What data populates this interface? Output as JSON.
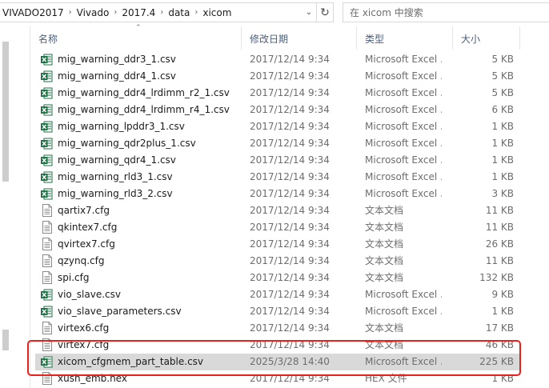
{
  "address": {
    "crumbs": [
      "VIVADO2017",
      "Vivado",
      "2017.4",
      "data",
      "xicom"
    ],
    "search_placeholder": "在 xicom 中搜索"
  },
  "columns": {
    "name": "名称",
    "date": "修改日期",
    "type": "类型",
    "size": "大小"
  },
  "rows": [
    {
      "name": "mig_warning_ddr3_1.csv",
      "date": "2017/12/14 9:34",
      "type": "Microsoft Excel ...",
      "size": "5 KB",
      "icon": "excel-csv-icon"
    },
    {
      "name": "mig_warning_ddr4_1.csv",
      "date": "2017/12/14 9:34",
      "type": "Microsoft Excel ...",
      "size": "5 KB",
      "icon": "excel-csv-icon"
    },
    {
      "name": "mig_warning_ddr4_lrdimm_r2_1.csv",
      "date": "2017/12/14 9:34",
      "type": "Microsoft Excel ...",
      "size": "5 KB",
      "icon": "excel-csv-icon"
    },
    {
      "name": "mig_warning_ddr4_lrdimm_r4_1.csv",
      "date": "2017/12/14 9:34",
      "type": "Microsoft Excel ...",
      "size": "6 KB",
      "icon": "excel-csv-icon"
    },
    {
      "name": "mig_warning_lpddr3_1.csv",
      "date": "2017/12/14 9:34",
      "type": "Microsoft Excel ...",
      "size": "1 KB",
      "icon": "excel-csv-icon"
    },
    {
      "name": "mig_warning_qdr2plus_1.csv",
      "date": "2017/12/14 9:34",
      "type": "Microsoft Excel ...",
      "size": "1 KB",
      "icon": "excel-csv-icon"
    },
    {
      "name": "mig_warning_qdr4_1.csv",
      "date": "2017/12/14 9:34",
      "type": "Microsoft Excel ...",
      "size": "1 KB",
      "icon": "excel-csv-icon"
    },
    {
      "name": "mig_warning_rld3_1.csv",
      "date": "2017/12/14 9:34",
      "type": "Microsoft Excel ...",
      "size": "1 KB",
      "icon": "excel-csv-icon"
    },
    {
      "name": "mig_warning_rld3_2.csv",
      "date": "2017/12/14 9:34",
      "type": "Microsoft Excel ...",
      "size": "3 KB",
      "icon": "excel-csv-icon"
    },
    {
      "name": "qartix7.cfg",
      "date": "2017/12/14 9:34",
      "type": "文本文档",
      "size": "11 KB",
      "icon": "text-file-icon"
    },
    {
      "name": "qkintex7.cfg",
      "date": "2017/12/14 9:34",
      "type": "文本文档",
      "size": "11 KB",
      "icon": "text-file-icon"
    },
    {
      "name": "qvirtex7.cfg",
      "date": "2017/12/14 9:34",
      "type": "文本文档",
      "size": "26 KB",
      "icon": "text-file-icon"
    },
    {
      "name": "qzynq.cfg",
      "date": "2017/12/14 9:34",
      "type": "文本文档",
      "size": "11 KB",
      "icon": "text-file-icon"
    },
    {
      "name": "spi.cfg",
      "date": "2017/12/14 9:34",
      "type": "文本文档",
      "size": "132 KB",
      "icon": "text-file-icon"
    },
    {
      "name": "vio_slave.csv",
      "date": "2017/12/14 9:34",
      "type": "Microsoft Excel ...",
      "size": "9 KB",
      "icon": "excel-csv-icon"
    },
    {
      "name": "vio_slave_parameters.csv",
      "date": "2017/12/14 9:34",
      "type": "Microsoft Excel ...",
      "size": "1 KB",
      "icon": "excel-csv-icon"
    },
    {
      "name": "virtex6.cfg",
      "date": "2017/12/14 9:34",
      "type": "文本文档",
      "size": "17 KB",
      "icon": "text-file-icon"
    },
    {
      "name": "virtex7.cfg",
      "date": "2017/12/14 9:34",
      "type": "文本文档",
      "size": "46 KB",
      "icon": "text-file-icon"
    },
    {
      "name": "xicom_cfgmem_part_table.csv",
      "date": "2025/3/28 14:40",
      "type": "Microsoft Excel ...",
      "size": "225 KB",
      "icon": "excel-csv-icon",
      "selected": true
    },
    {
      "name": "xush_emb.hex",
      "date": "2017/12/14 9:34",
      "type": "HEX 文件",
      "size": "1 KB",
      "icon": "text-file-icon"
    }
  ],
  "colors": {
    "highlight": "#e8211d",
    "selected_row": "#d9d9d9",
    "excel_green": "#1e7145"
  }
}
